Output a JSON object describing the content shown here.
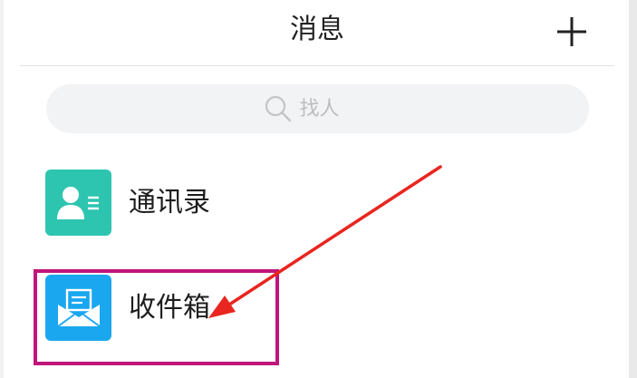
{
  "header": {
    "title": "消息",
    "add_icon": "plus-icon"
  },
  "search": {
    "placeholder": "找人",
    "icon": "search-icon"
  },
  "list": {
    "items": [
      {
        "label": "通讯录",
        "icon": "contact-card-icon",
        "color": "#2ec5b0"
      },
      {
        "label": "收件箱",
        "icon": "mail-envelope-icon",
        "color": "#1aa7f0"
      }
    ]
  },
  "annotations": {
    "highlight_color": "#c0157a",
    "arrow_color": "#e8261f"
  }
}
